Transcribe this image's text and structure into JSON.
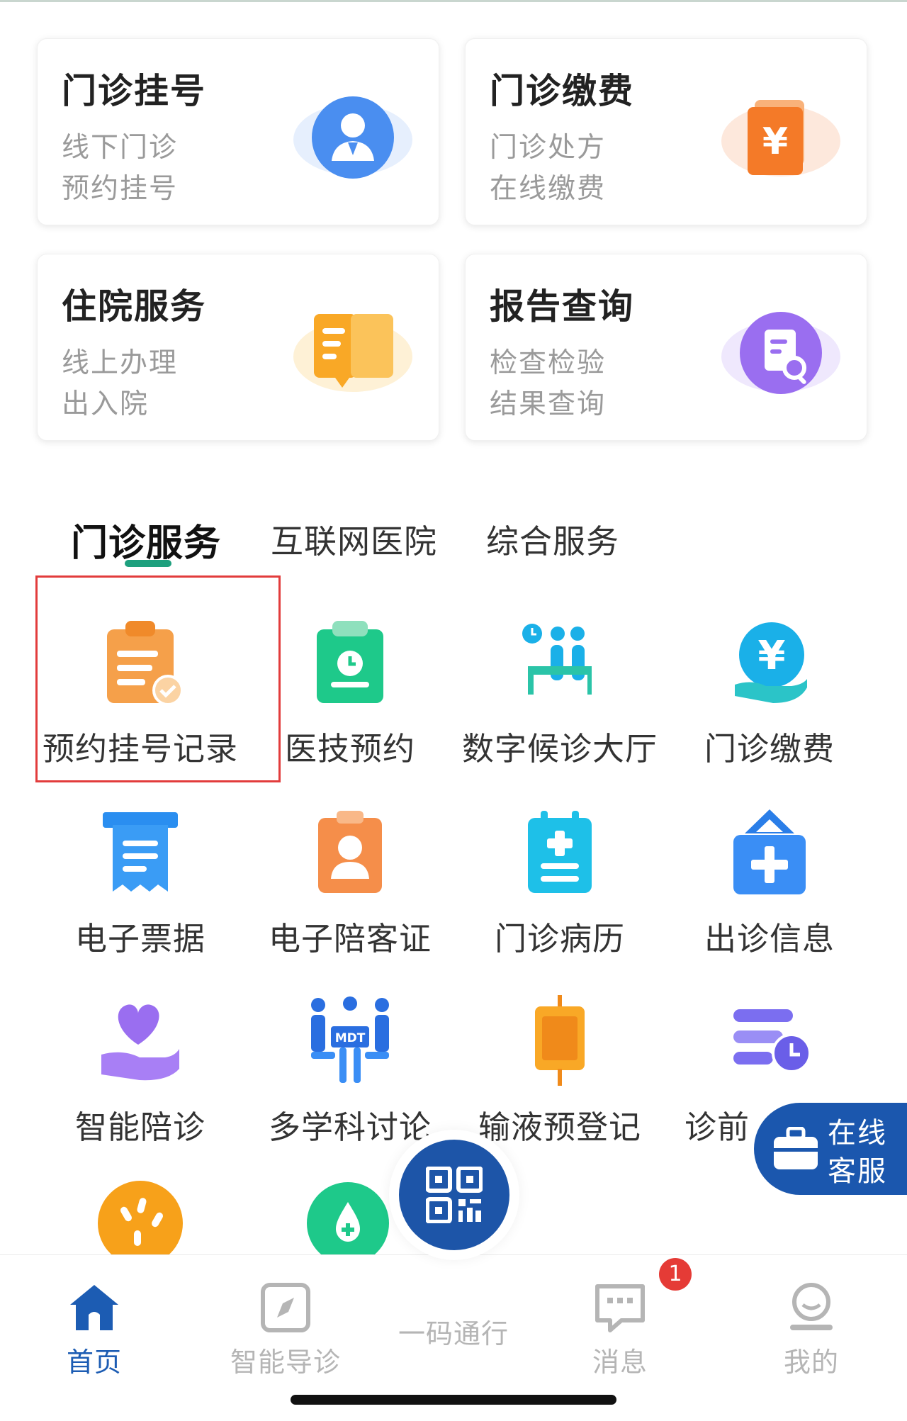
{
  "cards": [
    {
      "title": "门诊挂号",
      "line1": "线下门诊",
      "line2": "预约挂号",
      "icon": "doctor-icon",
      "color": "#4a8ef0"
    },
    {
      "title": "门诊缴费",
      "line1": "门诊处方",
      "line2": "在线缴费",
      "icon": "yuan-bill-icon",
      "color": "#f47a28"
    },
    {
      "title": "住院服务",
      "line1": "线上办理",
      "line2": "出入院",
      "icon": "document-folder-icon",
      "color": "#f9a826"
    },
    {
      "title": "报告查询",
      "line1": "检查检验",
      "line2": "结果查询",
      "icon": "report-search-icon",
      "color": "#9a6ef0"
    }
  ],
  "tabs": [
    {
      "label": "门诊服务",
      "active": true
    },
    {
      "label": "互联网医院",
      "active": false
    },
    {
      "label": "综合服务",
      "active": false
    }
  ],
  "grid": [
    {
      "label": "预约挂号记录",
      "icon": "clipboard-check-icon"
    },
    {
      "label": "医技预约",
      "icon": "clipboard-clock-icon"
    },
    {
      "label": "数字候诊大厅",
      "icon": "waiting-room-icon"
    },
    {
      "label": "门诊缴费",
      "icon": "yuan-hand-icon"
    },
    {
      "label": "电子票据",
      "icon": "receipt-icon"
    },
    {
      "label": "电子陪客证",
      "icon": "badge-person-icon"
    },
    {
      "label": "门诊病历",
      "icon": "medical-record-icon"
    },
    {
      "label": "出诊信息",
      "icon": "medical-kit-icon"
    },
    {
      "label": "智能陪诊",
      "icon": "heart-hand-icon"
    },
    {
      "label": "多学科讨论",
      "icon": "mdt-meeting-icon"
    },
    {
      "label": "输液预登记",
      "icon": "iv-bag-icon"
    },
    {
      "label": "诊前",
      "icon": "schedule-clock-icon"
    }
  ],
  "mdt_text": "MDT",
  "floating_service": {
    "line1": "在线",
    "line2": "客服"
  },
  "bottom_nav": [
    {
      "label": "首页",
      "icon": "home-icon",
      "active": true
    },
    {
      "label": "智能导诊",
      "icon": "compass-icon",
      "active": false
    },
    {
      "label": "一码通行",
      "icon": "qr-code-icon",
      "active": false
    },
    {
      "label": "消息",
      "icon": "message-icon",
      "active": false
    },
    {
      "label": "我的",
      "icon": "user-icon",
      "active": false
    }
  ],
  "message_badge": "1"
}
